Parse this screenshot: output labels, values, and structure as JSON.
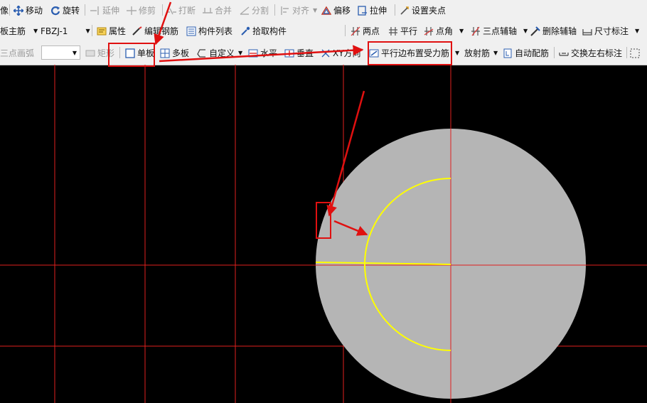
{
  "toolbar1": {
    "items": [
      {
        "label": "像",
        "icon": "cut-off-icon",
        "enabled": true
      },
      {
        "label": "移动",
        "icon": "move-icon",
        "enabled": true
      },
      {
        "label": "旋转",
        "icon": "rotate-icon",
        "enabled": true
      },
      {
        "label": "延伸",
        "icon": "extend-icon",
        "enabled": false
      },
      {
        "label": "修剪",
        "icon": "trim-icon",
        "enabled": false
      },
      {
        "label": "打断",
        "icon": "break-icon",
        "enabled": false
      },
      {
        "label": "合并",
        "icon": "merge-icon",
        "enabled": false
      },
      {
        "label": "分割",
        "icon": "split-icon",
        "enabled": false
      },
      {
        "label": "对齐",
        "icon": "align-icon",
        "enabled": false
      },
      {
        "label": "偏移",
        "icon": "offset-icon",
        "enabled": true
      },
      {
        "label": "拉伸",
        "icon": "stretch-icon",
        "enabled": true
      },
      {
        "label": "设置夹点",
        "icon": "grip-point-icon",
        "enabled": true
      }
    ]
  },
  "toolbar2": {
    "type_select": "板主筋",
    "component_select": "FBZJ-1",
    "items": [
      {
        "label": "属性",
        "icon": "properties-icon"
      },
      {
        "label": "编辑钢筋",
        "icon": "edit-rebar-icon"
      },
      {
        "label": "构件列表",
        "icon": "component-list-icon"
      },
      {
        "label": "拾取构件",
        "icon": "pick-component-icon"
      }
    ],
    "axis_items": [
      {
        "label": "两点",
        "icon": "two-point-axis-icon"
      },
      {
        "label": "平行",
        "icon": "parallel-axis-icon"
      },
      {
        "label": "点角",
        "icon": "point-angle-icon"
      },
      {
        "label": "三点辅轴",
        "icon": "three-point-axis-icon"
      },
      {
        "label": "删除辅轴",
        "icon": "delete-axis-icon"
      },
      {
        "label": "尺寸标注",
        "icon": "dimension-icon"
      }
    ]
  },
  "toolbar3": {
    "arc_label": "三点画弧",
    "items": [
      {
        "label": "矩形",
        "icon": "rectangle-icon",
        "enabled": false
      },
      {
        "label": "单板",
        "icon": "single-slab-icon",
        "enabled": true
      },
      {
        "label": "多板",
        "icon": "multi-slab-icon",
        "enabled": true
      },
      {
        "label": "自定义",
        "icon": "custom-icon",
        "enabled": true
      },
      {
        "label": "水平",
        "icon": "horizontal-icon",
        "enabled": true
      },
      {
        "label": "垂直",
        "icon": "vertical-icon",
        "enabled": true
      },
      {
        "label": "XY方向",
        "icon": "xy-direction-icon",
        "enabled": true
      },
      {
        "label": "平行边布置受力筋",
        "icon": "parallel-edge-rebar-icon",
        "enabled": true
      },
      {
        "label": "放射筋",
        "icon": "radial-rebar-icon",
        "enabled": true
      },
      {
        "label": "自动配筋",
        "icon": "auto-rebar-icon",
        "enabled": true
      },
      {
        "label": "交换左右标注",
        "icon": "swap-labels-icon",
        "enabled": true
      }
    ]
  },
  "colors": {
    "toolbar_bg": "#f0f0f0",
    "canvas_bg": "#000000",
    "grid_line": "#e0201e",
    "slab_fill": "#b5b5b5",
    "rebar": "#ffff00",
    "annotation": "#e01010"
  }
}
